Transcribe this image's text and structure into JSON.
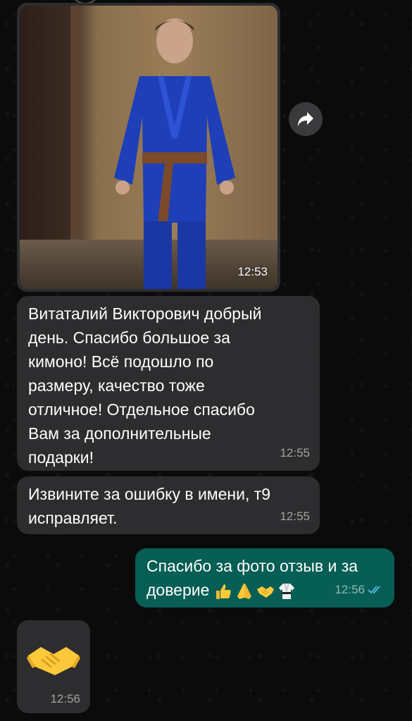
{
  "chat": {
    "messages": [
      {
        "type": "image",
        "direction": "incoming",
        "time": "12:53"
      },
      {
        "type": "text",
        "direction": "incoming",
        "text": "Витаталий Викторович добрый\nдень. Спасибо большое за\nкимоно! Всё подошло по\nразмеру, качество тоже\nотличное! Отдельное спасибо\nВам за дополнительные\nподарки!",
        "time": "12:55"
      },
      {
        "type": "text",
        "direction": "incoming",
        "text": "Извините за ошибку в имени, т9\nисправляет.",
        "time": "12:55"
      },
      {
        "type": "text",
        "direction": "outgoing",
        "text": "Спасибо за фото отзыв и за\nдоверие",
        "emojis": [
          "thumbs-up",
          "folded-hands",
          "handshake",
          "martial-arts-uniform"
        ],
        "time": "12:56",
        "status": "read"
      },
      {
        "type": "emoji",
        "direction": "incoming",
        "emoji": "handshake",
        "time": "12:56"
      }
    ]
  },
  "icons": {
    "forward": "forward-arrow-icon",
    "read_status": "double-check-icon"
  },
  "colors": {
    "incoming_bubble": "#2d2d2f",
    "outgoing_bubble": "#075e54",
    "background": "#0b0b0b",
    "read_tick": "#53bdeb"
  }
}
